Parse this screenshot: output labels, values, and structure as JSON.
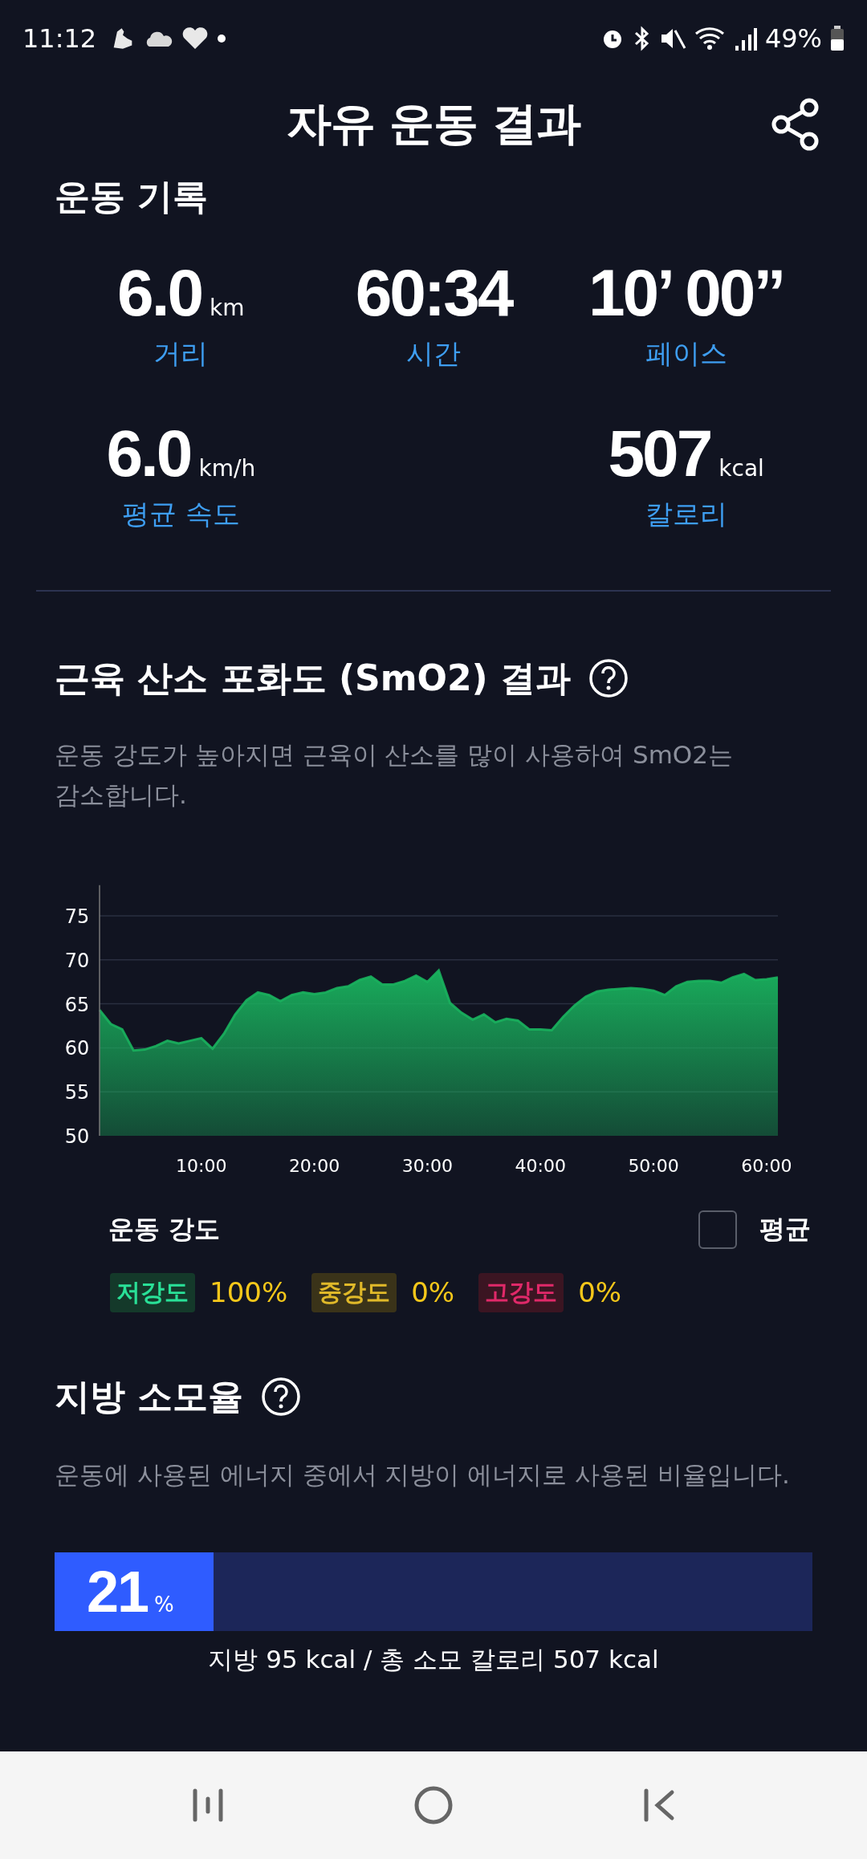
{
  "status_bar": {
    "time": "11:12",
    "battery": "49%"
  },
  "header": {
    "title": "자유 운동 결과"
  },
  "record": {
    "title": "운동 기록",
    "rows": [
      [
        {
          "value": "6.0",
          "unit": "km",
          "label": "거리"
        },
        {
          "value": "60:34",
          "label": "시간"
        },
        {
          "value": "10’ 00”",
          "label": "페이스"
        }
      ],
      [
        {
          "value": "6.0",
          "unit": "km/h",
          "label": "평균 속도"
        },
        "",
        {
          "value": "507",
          "unit": "kcal",
          "label": "칼로리"
        }
      ]
    ]
  },
  "smo2": {
    "title": "근육 산소 포화도 (SmO2) 결과",
    "description": "운동 강도가 높아지면 근육이 산소를 많이 사용하여 SmO2는 감소합니다.",
    "chart_data": {
      "type": "area",
      "x": [
        1,
        2,
        3,
        4,
        5,
        6,
        7,
        8,
        9,
        10,
        11,
        12,
        13,
        14,
        15,
        16,
        17,
        18,
        19,
        20,
        21,
        22,
        23,
        24,
        25,
        26,
        27,
        28,
        29,
        30,
        31,
        32,
        33,
        34,
        35,
        36,
        37,
        38,
        39,
        40,
        41,
        42,
        43,
        44,
        45,
        46,
        47,
        48,
        49,
        50,
        51,
        52,
        53,
        54,
        55,
        56,
        57,
        58,
        59,
        60,
        61
      ],
      "grid": true,
      "series": [
        {
          "color": "#19b35e",
          "values": [
            64.3,
            62.7,
            62.1,
            59.7,
            59.8,
            60.2,
            60.8,
            60.5,
            60.8,
            61.1,
            59.9,
            61.6,
            63.8,
            65.4,
            66.3,
            66.0,
            65.3,
            66.0,
            66.3,
            66.1,
            66.3,
            66.8,
            67.0,
            67.7,
            68.1,
            67.2,
            67.2,
            67.6,
            68.2,
            67.5,
            68.8,
            65.1,
            64.0,
            63.2,
            63.8,
            62.9,
            63.3,
            63.1,
            62.1,
            62.1,
            62.0,
            63.5,
            64.8,
            65.8,
            66.4,
            66.6,
            66.7,
            66.8,
            66.7,
            66.5,
            66.0,
            67.0,
            67.5,
            67.6,
            67.6,
            67.4,
            68.0,
            68.4,
            67.7,
            67.8,
            68.0
          ]
        }
      ],
      "xlim": [
        1,
        61
      ],
      "ylim": [
        50,
        78.5
      ],
      "xticks": [
        {
          "value": 10,
          "label": "10:00"
        },
        {
          "value": 20,
          "label": "20:00"
        },
        {
          "value": 30,
          "label": "30:00"
        },
        {
          "value": 40,
          "label": "40:00"
        },
        {
          "value": 50,
          "label": "50:00"
        },
        {
          "value": 60,
          "label": "60:00"
        }
      ],
      "yticks": [
        50,
        55,
        60,
        65,
        70,
        75
      ]
    },
    "legend": {
      "title": "운동 강도",
      "average": {
        "label": "평균",
        "checked": false
      },
      "levels": [
        {
          "label": "저강도",
          "value": "100%",
          "color": "#14392a"
        },
        {
          "label": "중강도",
          "value": "0%",
          "color": "#3a3319"
        },
        {
          "label": "고강도",
          "value": "0%",
          "color": "#3b1522"
        }
      ]
    }
  },
  "fat": {
    "title": "지방 소모율",
    "description": "운동에 사용된 에너지 중에서 지방이 에너지로 사용된 비율입니다.",
    "bar": {
      "value": "21",
      "unit": "%",
      "level": 0.21
    },
    "caption": "지방 95 kcal / 총 소모 칼로리 507 kcal"
  }
}
